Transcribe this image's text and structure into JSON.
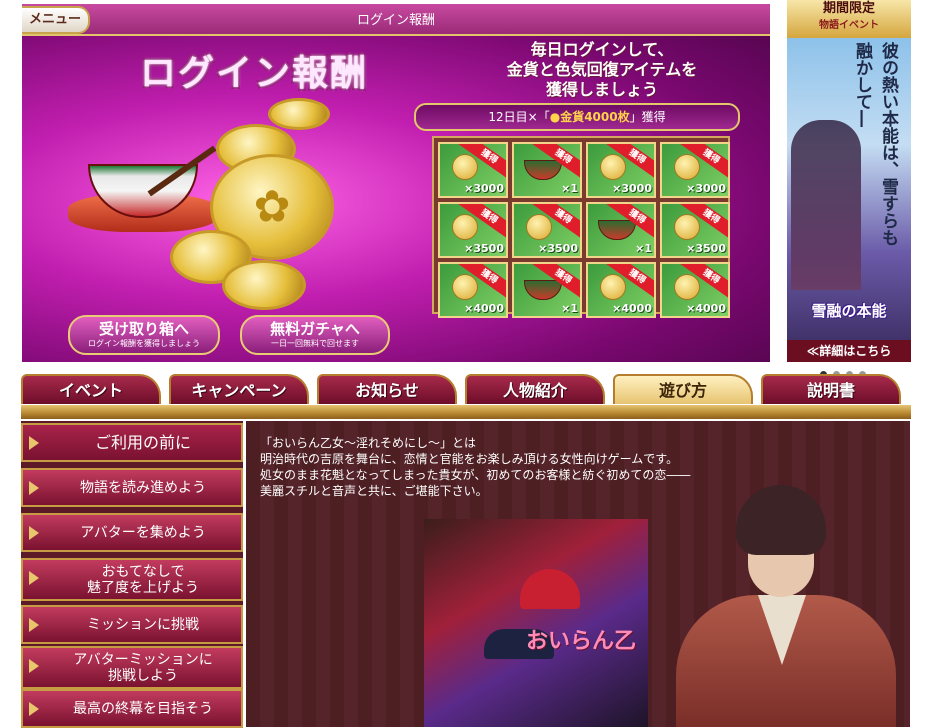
{
  "login": {
    "menu_label": "メニュー",
    "header_title": "ログイン報酬",
    "big_title": "ログイン報酬",
    "subtitle_lines": [
      "毎日ログインして、",
      "金貨と色気回復アイテムを",
      "獲得しましょう"
    ],
    "progress": {
      "prefix": "12日目×「",
      "reward": "●金貨4000枚",
      "suffix": "」獲得"
    },
    "grid": [
      {
        "icon": "coin-icon",
        "stamp": "獲得",
        "qty": "×3000"
      },
      {
        "icon": "tea-bowl-icon",
        "stamp": "獲得",
        "qty": "×1"
      },
      {
        "icon": "coin-icon",
        "stamp": "獲得",
        "qty": "×3000"
      },
      {
        "icon": "coin-icon",
        "stamp": "獲得",
        "qty": "×3000"
      },
      {
        "icon": "coin-icon",
        "stamp": "獲得",
        "qty": "×3500"
      },
      {
        "icon": "coin-icon",
        "stamp": "獲得",
        "qty": "×3500"
      },
      {
        "icon": "tea-bowl-icon",
        "stamp": "獲得",
        "qty": "×1"
      },
      {
        "icon": "coin-icon",
        "stamp": "獲得",
        "qty": "×3500"
      },
      {
        "icon": "coin-icon",
        "stamp": "獲得",
        "qty": "×4000"
      },
      {
        "icon": "tea-bowl-icon",
        "stamp": "獲得",
        "qty": "×1"
      },
      {
        "icon": "coin-icon",
        "stamp": "獲得",
        "qty": "×4000"
      },
      {
        "icon": "coin-icon",
        "stamp": "獲得",
        "qty": "×4000"
      }
    ],
    "buttons": [
      {
        "main": "受け取り箱へ",
        "sub": "ログイン報酬を獲得しましょう"
      },
      {
        "main": "無料ガチャへ",
        "sub": "一日一回無料で回せます"
      }
    ]
  },
  "banner": {
    "top_line1": "期間限定",
    "top_line2": "物語イベント",
    "vertical_text": "彼の熱い本能は、雪すらも融かして―",
    "logo_text": "雪融の本能",
    "detail_label": "≪詳細はこちら",
    "dot_count": 4,
    "active_dot": 1
  },
  "tabs": [
    {
      "label": "イベント",
      "active": false
    },
    {
      "label": "キャンペーン",
      "active": false
    },
    {
      "label": "お知らせ",
      "active": false
    },
    {
      "label": "人物紹介",
      "active": false
    },
    {
      "label": "遊び方",
      "active": true
    },
    {
      "label": "説明書",
      "active": false
    }
  ],
  "sidebar": [
    {
      "lines": [
        "ご利用の前に"
      ]
    },
    {
      "lines": [
        "物語を読み進めよう"
      ]
    },
    {
      "lines": [
        "アバターを集めよう"
      ]
    },
    {
      "lines": [
        "おもてなしで",
        "魅了度を上げよう"
      ]
    },
    {
      "lines": [
        "ミッションに挑戦"
      ]
    },
    {
      "lines": [
        "アバターミッションに",
        "挑戦しよう"
      ]
    },
    {
      "lines": [
        "最高の終幕を目指そう"
      ]
    }
  ],
  "content": {
    "intro_lines": [
      "「おいらん乙女～淫れそめにし～」とは",
      "明治時代の吉原を舞台に、恋情と官能をお楽しみ頂ける女性向けゲームです。",
      "処女のまま花魁となってしまった貴女が、初めてのお客様と紡ぐ初めての恋――",
      "美麗スチルと音声と共に、ご堪能下さい。"
    ],
    "cover_title": "おいらん乙"
  }
}
